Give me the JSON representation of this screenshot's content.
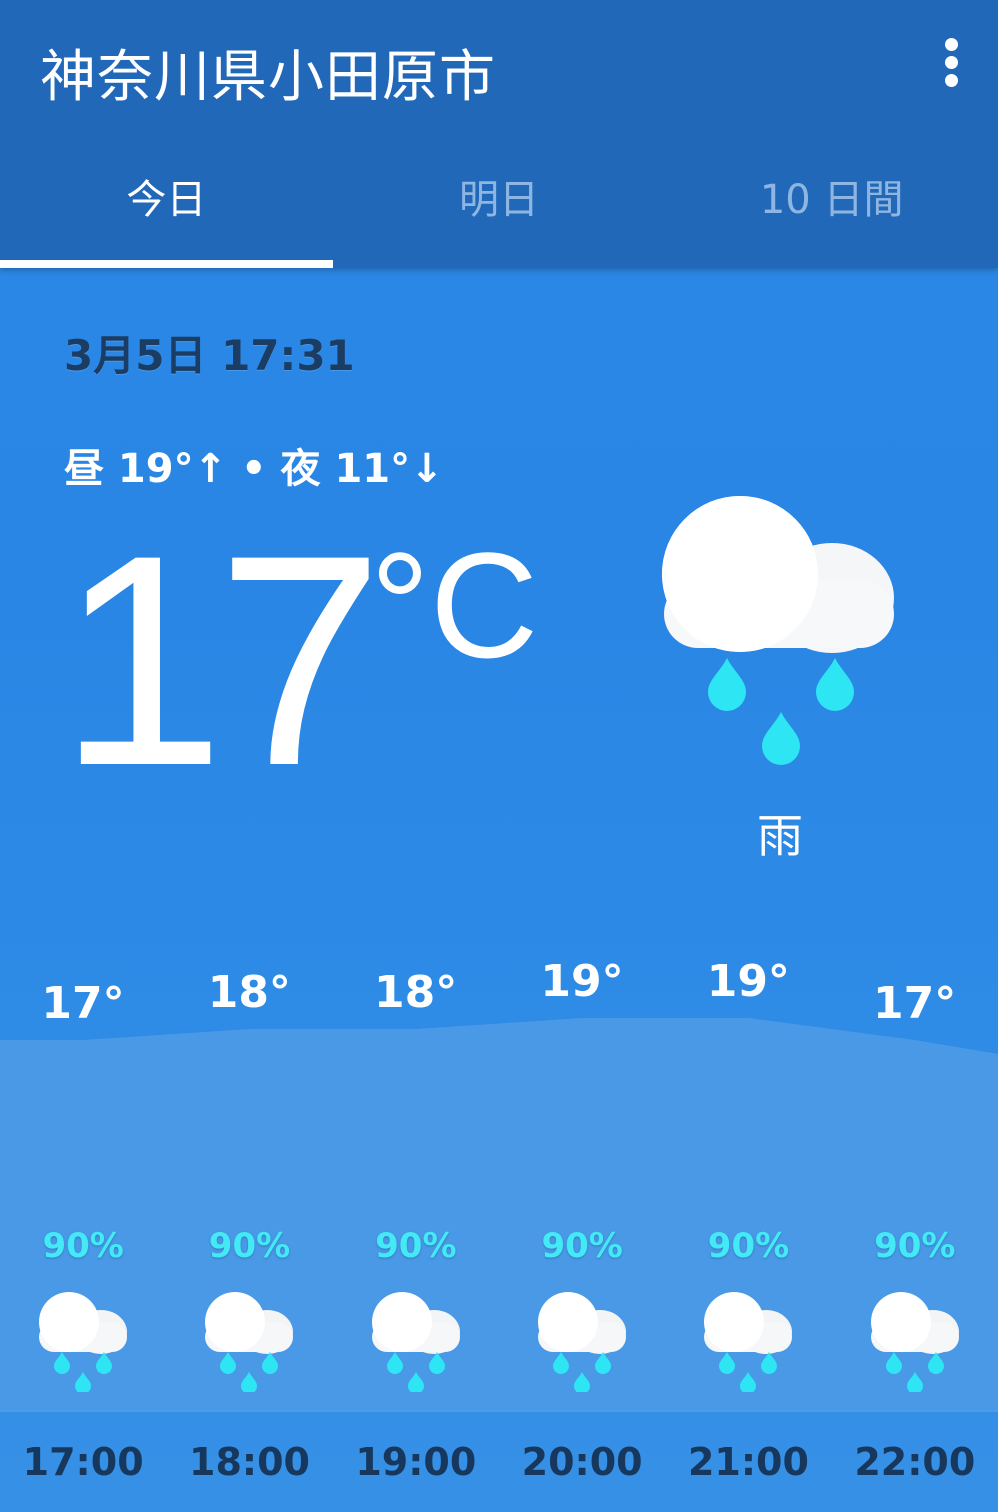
{
  "header": {
    "title": "神奈川県小田原市"
  },
  "tabs": [
    {
      "label": "今日",
      "active": true
    },
    {
      "label": "明日",
      "active": false
    },
    {
      "label": "10 日間",
      "active": false
    }
  ],
  "current": {
    "datetime": "3月5日 17:31",
    "hilo": "昼 19°↑ • 夜 11°↓",
    "temperature": "17",
    "unit": "°C",
    "condition": "雨",
    "icon": "rain-cloud-icon"
  },
  "hourly": [
    {
      "temp": "17°",
      "precip": "90%",
      "time": "17:00",
      "icon": "rain-cloud-icon"
    },
    {
      "temp": "18°",
      "precip": "90%",
      "time": "18:00",
      "icon": "rain-cloud-icon"
    },
    {
      "temp": "18°",
      "precip": "90%",
      "time": "19:00",
      "icon": "rain-cloud-icon"
    },
    {
      "temp": "19°",
      "precip": "90%",
      "time": "20:00",
      "icon": "rain-cloud-icon"
    },
    {
      "temp": "19°",
      "precip": "90%",
      "time": "21:00",
      "icon": "rain-cloud-icon"
    },
    {
      "temp": "17°",
      "precip": "90%",
      "time": "22:00",
      "icon": "rain-cloud-icon"
    }
  ],
  "hourly_temp_values": [
    17,
    18,
    18,
    19,
    19,
    17
  ],
  "colors": {
    "appbar": "#2268b8",
    "background": "#2a86e4",
    "precip": "#43eaf5",
    "raindrop": "#2ee6f3",
    "time_text": "#17385c"
  }
}
